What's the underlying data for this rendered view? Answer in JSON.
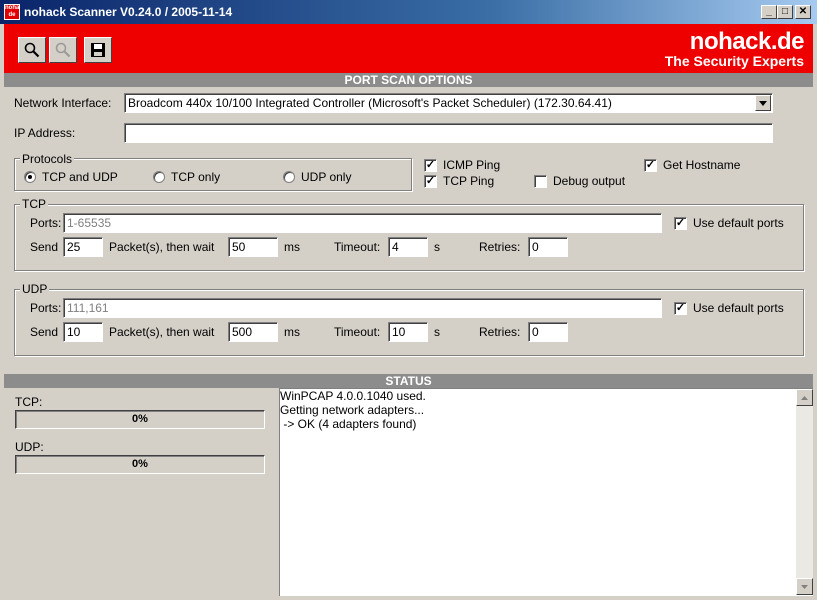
{
  "window": {
    "title": "nohack Scanner V0.24.0 / 2005-11-14",
    "icon_text": "nohack de",
    "controls": {
      "minimize": "_",
      "maximize": "□",
      "close": "✕"
    }
  },
  "toolbar": {
    "buttons": [
      {
        "icon": "search-icon",
        "enabled": true
      },
      {
        "icon": "search-icon",
        "enabled": false
      },
      {
        "icon": "save-icon",
        "enabled": true
      }
    ]
  },
  "brand": {
    "name": "nohack.de",
    "tagline": "The Security Experts",
    "color": "#ee0000"
  },
  "options": {
    "header": "PORT SCAN OPTIONS",
    "network_interface_label": "Network Interface:",
    "network_interface_value": "Broadcom 440x 10/100 Integrated Controller (Microsoft's Packet Scheduler)  (172.30.64.41)",
    "ip_label": "IP Address:",
    "ip_value": ""
  },
  "protocols": {
    "title": "Protocols",
    "options": [
      {
        "label": "TCP and UDP",
        "checked": true
      },
      {
        "label": "TCP only",
        "checked": false
      },
      {
        "label": "UDP only",
        "checked": false
      }
    ]
  },
  "checkboxes": {
    "icmp_ping": {
      "label": "ICMP Ping",
      "checked": true
    },
    "tcp_ping": {
      "label": "TCP Ping",
      "checked": true
    },
    "debug_output": {
      "label": "Debug output",
      "checked": false
    },
    "get_hostname": {
      "label": "Get Hostname",
      "checked": true
    }
  },
  "tcp": {
    "title": "TCP",
    "ports_label": "Ports:",
    "ports_value": "1-65535",
    "use_default": {
      "label": "Use default ports",
      "checked": true
    },
    "send_label": "Send",
    "send_value": "25",
    "packets_label": "Packet(s), then wait",
    "wait_value": "50",
    "ms_label": "ms",
    "timeout_label": "Timeout:",
    "timeout_value": "4",
    "s_label": "s",
    "retries_label": "Retries:",
    "retries_value": "0"
  },
  "udp": {
    "title": "UDP",
    "ports_label": "Ports:",
    "ports_value": "111,161",
    "use_default": {
      "label": "Use default ports",
      "checked": true
    },
    "send_label": "Send",
    "send_value": "10",
    "packets_label": "Packet(s), then wait",
    "wait_value": "500",
    "ms_label": "ms",
    "timeout_label": "Timeout:",
    "timeout_value": "10",
    "s_label": "s",
    "retries_label": "Retries:",
    "retries_value": "0"
  },
  "status": {
    "header": "STATUS",
    "tcp_label": "TCP:",
    "tcp_progress": "0%",
    "udp_label": "UDP:",
    "udp_progress": "0%",
    "log": [
      "WinPCAP 4.0.0.1040 used.",
      "Getting network adapters...",
      " -> OK (4 adapters found)"
    ]
  }
}
